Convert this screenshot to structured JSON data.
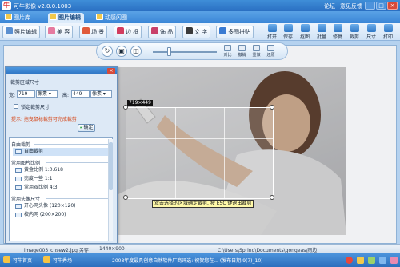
{
  "app": {
    "title": "可牛影像 v2.0.0.1003",
    "links": [
      "论坛",
      "意见反馈"
    ]
  },
  "main_tabs": [
    {
      "label": "图片库",
      "active": false
    },
    {
      "label": "图片编辑",
      "active": true
    },
    {
      "label": "动感闪图",
      "active": false
    }
  ],
  "toolbar": {
    "tools": [
      "照片编辑",
      "美 容",
      "场 景",
      "边 框",
      "饰 品",
      "文 字",
      "多图拼贴"
    ],
    "actions": [
      "打开",
      "保存",
      "抠图",
      "批量",
      "修复",
      "裁剪",
      "尺寸",
      "打印"
    ]
  },
  "canvas_controls": {
    "items": [
      "对比",
      "撤销",
      "重做",
      "还原"
    ]
  },
  "crop_panel": {
    "title": "裁剪区域尺寸",
    "width_label": "宽:",
    "width_value": "719",
    "height_label": "高:",
    "height_value": "449",
    "unit": "像素",
    "lock_ratio_label": "锁定裁剪尺寸",
    "tip": "提示: 拖曳鼠标裁剪可完成裁剪",
    "ok_label": "确定",
    "groups": [
      {
        "title": "自由裁剪",
        "items": [
          "自由裁剪"
        ]
      },
      {
        "title": "常用图片比例",
        "items": [
          "黄金比例 1:0.618",
          "亮度一些 1:1",
          "常用双比例 4:3"
        ]
      },
      {
        "title": "常用头像尺寸",
        "items": [
          "开心网头像 (120×120)",
          "校内网 (200×200)"
        ]
      }
    ],
    "selected_item": "自由裁剪"
  },
  "crop_overlay": {
    "size_label": "719×449",
    "hint": "双击选择的区域确定裁剪, 按 ESC 键退出裁剪"
  },
  "status": {
    "filename": "image003_cnsew2.jpg 另存",
    "dimensions": "1440×900",
    "path": "C:\\Users\\Spring\\Documents\\gongeas\\雨边"
  },
  "bottom": {
    "items": [
      "可牛首页",
      "可牛秀场"
    ],
    "news": "2008年度最具创意自然软件厂商评选: 祝贺您在... (发布日期:9(7)_10)"
  },
  "colors": {
    "accent": "#2a6fc2",
    "panel_bg": "#dde9f6",
    "tip": "#d6481a"
  }
}
